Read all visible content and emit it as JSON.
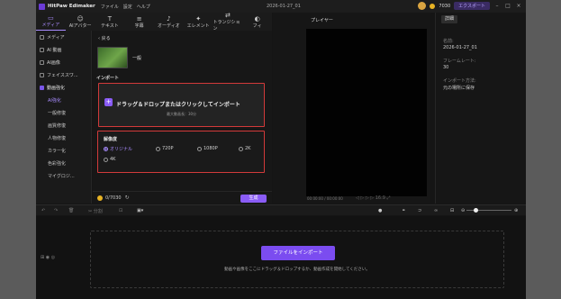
{
  "app": {
    "title": "HitPaw Edimaker",
    "menu": [
      "ファイル",
      "設定",
      "ヘルプ"
    ],
    "project_name": "2026-01-27_01"
  },
  "account": {
    "coins": "7030",
    "export_label": "エクスポート"
  },
  "tabs": [
    {
      "label": "メディア",
      "icon": "media-icon",
      "glyph": "▭"
    },
    {
      "label": "AIアバター",
      "icon": "avatar-icon",
      "glyph": "☺"
    },
    {
      "label": "テキスト",
      "icon": "text-icon",
      "glyph": "T"
    },
    {
      "label": "字幕",
      "icon": "subtitle-icon",
      "glyph": "≡"
    },
    {
      "label": "オーディオ",
      "icon": "music-icon",
      "glyph": "♪"
    },
    {
      "label": "エレメント",
      "icon": "element-icon",
      "glyph": "✦"
    },
    {
      "label": "トランジション",
      "icon": "transition-icon",
      "glyph": "⇄"
    },
    {
      "label": "フィ",
      "icon": "filter-icon",
      "glyph": "◐"
    }
  ],
  "sidebar": {
    "items": [
      {
        "label": "メディア"
      },
      {
        "label": "AI 動画"
      },
      {
        "label": "AI画像"
      },
      {
        "label": "フェイススワ..."
      },
      {
        "label": "動画強化"
      }
    ],
    "subitems": [
      "AI強化",
      "一般修復",
      "画質修復",
      "人物修復",
      "カラー化",
      "色彩強化",
      "マイグロジ..."
    ]
  },
  "panel": {
    "back_label": "戻る",
    "model_label": "一般",
    "import_section": "インポート",
    "drop_text": "ドラッグ＆ドロップまたはクリックしてインポート",
    "drop_sub": "最大動画長：30分",
    "resolution_title": "解像度",
    "resolution_options": [
      "オリジナル",
      "720P",
      "1080P",
      "2K",
      "4K"
    ],
    "selected_resolution": "オリジナル",
    "cost": "0/7030",
    "generate_label": "生成"
  },
  "player": {
    "label": "プレイヤー",
    "timecode": "00:00:00 / 00:00:00",
    "controls": "◁  ▷  ▷  ▷  16:9  ⤢"
  },
  "details": {
    "tab": "詳細",
    "fields": [
      {
        "key": "名前:",
        "value": "2026-01-27_01"
      },
      {
        "key": "フレームレート:",
        "value": "30"
      },
      {
        "key": "インポート方法:",
        "value": "元の場所に保存"
      }
    ]
  },
  "timeline": {
    "split_label": "分割",
    "import_button": "ファイルをインポート",
    "hint": "動画や画像をここにドラッグ＆ドロップするか、動画作成を開始してください。"
  }
}
